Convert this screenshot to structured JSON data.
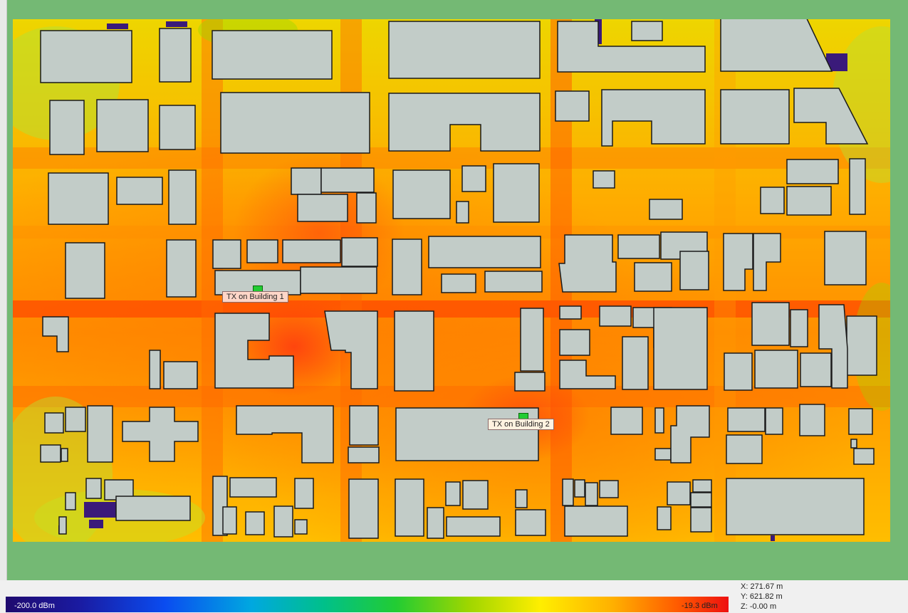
{
  "transmitters": [
    {
      "label": "TX on Building 1"
    },
    {
      "label": "TX on Building 2"
    }
  ],
  "legend": {
    "min_label": "-200.0 dBm",
    "max_label": "-19.3 dBm",
    "colors": [
      "#1f0a6e",
      "#0a4cf0",
      "#00c08a",
      "#22cc33",
      "#ffee00",
      "#ff5a00",
      "#ee1010"
    ]
  },
  "cursor": {
    "x_text": "X: 271.67 m",
    "y_text": "Y: 621.82 m",
    "z_text": "Z: -0.00 m"
  },
  "colors": {
    "background": "#74b974",
    "building": "#c2ccc8",
    "building_edge": "#1a1a1a",
    "shadow": "#3a1a7a"
  }
}
